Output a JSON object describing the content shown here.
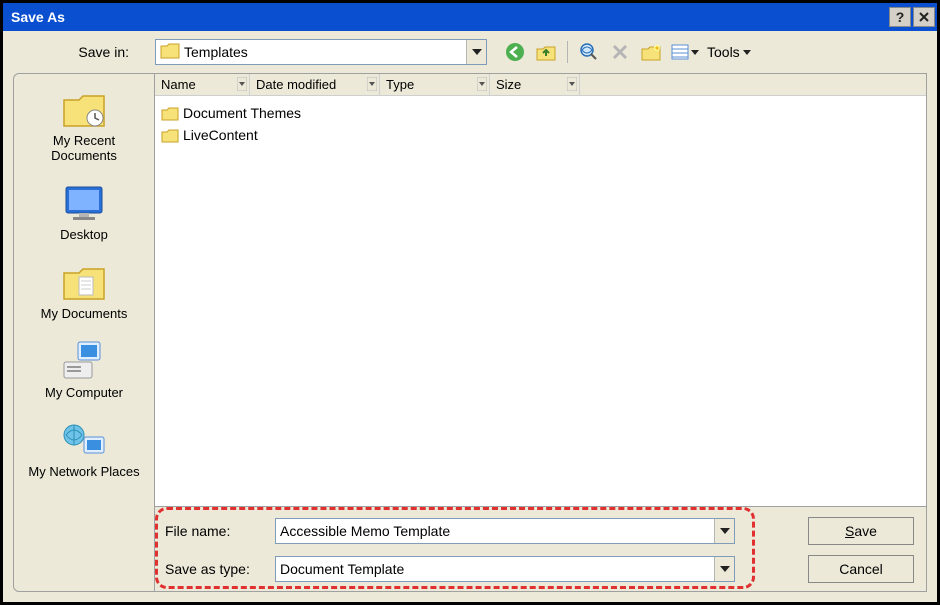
{
  "window": {
    "title": "Save As"
  },
  "toolbar": {
    "save_in_label": "Save in:",
    "save_in_value": "Templates",
    "tools_label": "Tools"
  },
  "columns": {
    "name": "Name",
    "date": "Date modified",
    "type": "Type",
    "size": "Size"
  },
  "places": [
    {
      "label": "My Recent Documents"
    },
    {
      "label": "Desktop"
    },
    {
      "label": "My Documents"
    },
    {
      "label": "My Computer"
    },
    {
      "label": "My Network Places"
    }
  ],
  "files": [
    {
      "name": "Document Themes"
    },
    {
      "name": "LiveContent"
    }
  ],
  "form": {
    "file_name_label": "File name:",
    "file_name_value": "Accessible Memo Template",
    "save_type_label": "Save as type:",
    "save_type_value": "Document Template"
  },
  "buttons": {
    "save_prefix": "S",
    "save_rest": "ave",
    "cancel": "Cancel"
  }
}
